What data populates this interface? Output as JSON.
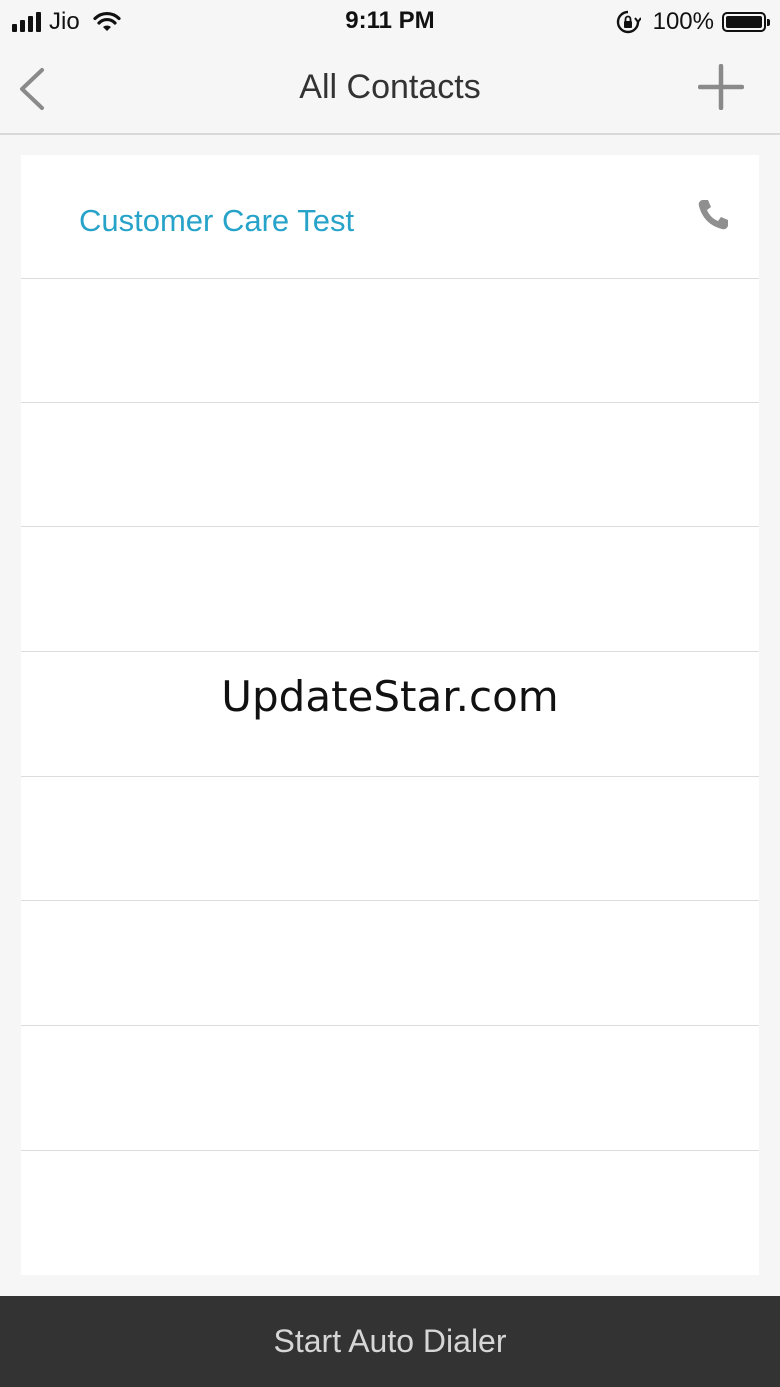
{
  "status_bar": {
    "carrier": "Jio",
    "time": "9:11 PM",
    "battery_percent": "100%",
    "battery_level": 1.0,
    "icons": [
      "signal-icon",
      "wifi-icon",
      "orientation-lock-icon",
      "battery-icon"
    ]
  },
  "nav": {
    "title": "All Contacts",
    "back_icon": "chevron-left-icon",
    "add_icon": "plus-icon"
  },
  "contacts": [
    {
      "name": "Customer Care Test",
      "icon": "phone-icon"
    },
    {
      "name": ""
    },
    {
      "name": ""
    },
    {
      "name": ""
    },
    {
      "name": ""
    },
    {
      "name": ""
    },
    {
      "name": ""
    },
    {
      "name": ""
    },
    {
      "name": ""
    }
  ],
  "watermark": "UpdateStar.com",
  "bottom": {
    "label": "Start Auto Dialer"
  },
  "colors": {
    "accent": "#27a3c9",
    "bottom_bar": "#333333",
    "background": "#f6f6f6"
  }
}
